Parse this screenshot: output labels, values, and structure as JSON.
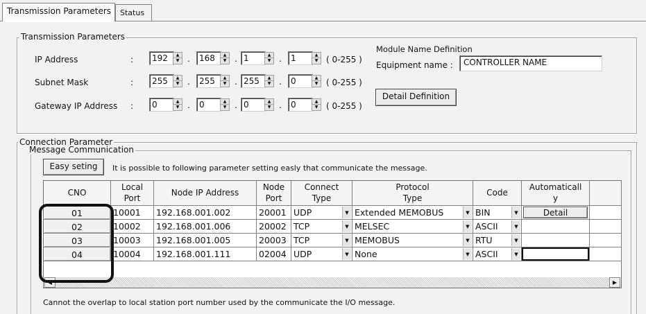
{
  "tabs": [
    {
      "label": "Transmission Parameters"
    },
    {
      "label": "Status"
    }
  ],
  "transmission": {
    "group_title": "Transmission Parameters",
    "colon": ":",
    "range": "( 0-255 )",
    "ip_address": {
      "label": "IP Address",
      "octets": [
        "192",
        "168",
        "1",
        "1"
      ]
    },
    "subnet_mask": {
      "label": "Subnet Mask",
      "octets": [
        "255",
        "255",
        "255",
        "0"
      ]
    },
    "gateway": {
      "label": "Gateway IP Address",
      "octets": [
        "0",
        "0",
        "0",
        "0"
      ]
    },
    "module_name": {
      "title": "Module Name Definition",
      "equipment_label": "Equipment name :",
      "equipment_value": "CONTROLLER NAME"
    },
    "detail_definition_label": "Detail Definition"
  },
  "connection": {
    "group_title": "Connection Parameter",
    "message_title": "Message Communication",
    "easy_setting_label": "Easy seting",
    "easy_setting_hint": "It is possible to following parameter setting easly that communicate the  message.",
    "columns": [
      "CNO",
      "Local\nPort",
      "Node IP Address",
      "Node\nPort",
      "Connect\nType",
      "Protocol\nType",
      "Code",
      "Automaticall\ny"
    ],
    "rows": [
      {
        "cno": "01",
        "local_port": "10001",
        "node_ip": "192.168.001.002",
        "node_port": "20001",
        "connect_type": "UDP",
        "protocol": "Extended MEMOBUS",
        "code": "BIN",
        "auto": "Detail"
      },
      {
        "cno": "02",
        "local_port": "10002",
        "node_ip": "192.168.001.006",
        "node_port": "20002",
        "connect_type": "TCP",
        "protocol": "MELSEC",
        "code": "ASCII",
        "auto": ""
      },
      {
        "cno": "03",
        "local_port": "10003",
        "node_ip": "192.168.001.005",
        "node_port": "20003",
        "connect_type": "TCP",
        "protocol": "MEMOBUS",
        "code": "RTU",
        "auto": ""
      },
      {
        "cno": "04",
        "local_port": "10004",
        "node_ip": "192.168.001.111",
        "node_port": "02004",
        "connect_type": "UDP",
        "protocol": "None",
        "code": "ASCII",
        "auto": ""
      }
    ],
    "footer_note": "Cannot the overlap to local station port number used by the communicate the  I/O message."
  },
  "icons": {
    "spin_up": "triangle-up-icon",
    "spin_down": "triangle-down-icon",
    "combo": "chevron-down-icon",
    "scroll_left": "scroll-left-icon",
    "scroll_right": "scroll-right-icon"
  }
}
